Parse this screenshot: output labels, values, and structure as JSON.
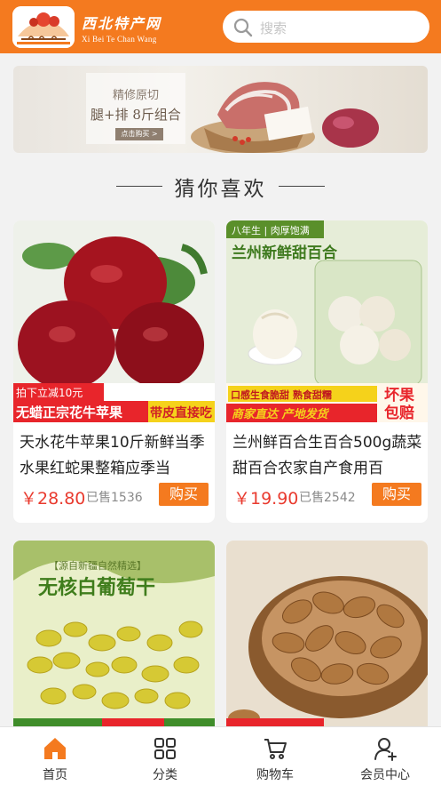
{
  "header": {
    "brand_cn": "西北特产网",
    "brand_en": "Xi Bei Te Chan Wang",
    "search_placeholder": "搜索"
  },
  "banner": {
    "subtitle": "精修原切",
    "title": "腿+排 8斤组合",
    "button": "点击购买 >"
  },
  "section": {
    "title": "猜你喜欢"
  },
  "products": [
    {
      "name": "天水花牛苹果10斤新鲜当季水果红蛇果整箱应季当",
      "price": "￥28.80",
      "sold": "已售1536",
      "buy": "购买",
      "img_text": [
        "拍下立减10元",
        "无蜡正宗花牛苹果",
        "带皮直接吃"
      ]
    },
    {
      "name": "兰州鲜百合生百合500g蔬菜甜百合农家自产食用百",
      "price": "￥19.90",
      "sold": "已售2542",
      "buy": "购买",
      "img_text": [
        "八年生 | 肉厚饱满",
        "兰州新鲜甜百合",
        "口感生食脆甜 熟食甜糯",
        "商家直达 产地发货",
        "坏果",
        "包赔"
      ]
    },
    {
      "img_text": [
        "【源自新疆自然精选】",
        "无核白葡萄干"
      ]
    },
    {
      "img_text": []
    }
  ],
  "tabs": [
    {
      "label": "首页",
      "icon": "home-icon",
      "active": true
    },
    {
      "label": "分类",
      "icon": "category-grid-icon",
      "active": false
    },
    {
      "label": "购物车",
      "icon": "cart-icon",
      "active": false
    },
    {
      "label": "会员中心",
      "icon": "member-icon",
      "active": false
    }
  ],
  "colors": {
    "brand": "#f47a1f",
    "price": "#e93b2f"
  }
}
